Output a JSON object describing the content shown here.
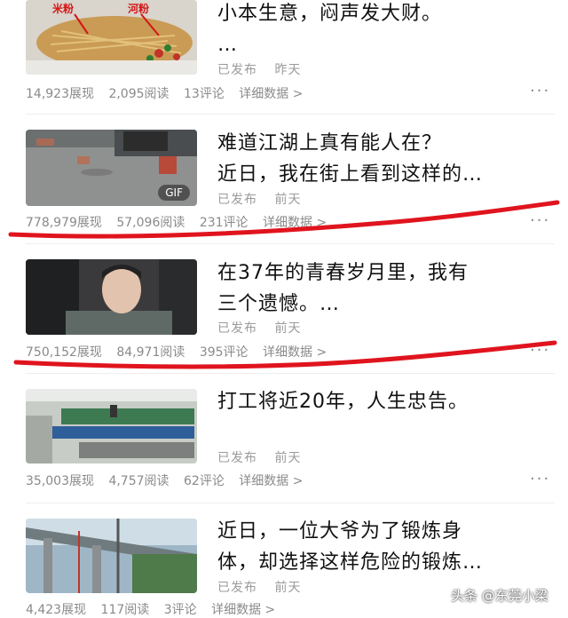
{
  "items": [
    {
      "title": "小本生意，闷声发大财。\n…",
      "status": "已发布",
      "time": "昨天",
      "views": "14,923展现",
      "reads": "2,095阅读",
      "comments": "13评论",
      "detail": "详细数据 >",
      "thumb_labels": [
        "米粉",
        "河粉"
      ]
    },
    {
      "title": "难道江湖上真有能人在？\n近日，我在街上看到这样的…",
      "status": "已发布",
      "time": "前天",
      "views": "778,979展现",
      "reads": "57,096阅读",
      "comments": "231评论",
      "detail": "详细数据 >",
      "badge": "GIF"
    },
    {
      "title": "在37年的青春岁月里，我有\n三个遗憾。…",
      "status": "已发布",
      "time": "前天",
      "views": "750,152展现",
      "reads": "84,971阅读",
      "comments": "395评论",
      "detail": "详细数据 >"
    },
    {
      "title": "打工将近20年，人生忠告。",
      "status": "已发布",
      "time": "前天",
      "views": "35,003展现",
      "reads": "4,757阅读",
      "comments": "62评论",
      "detail": "详细数据 >"
    },
    {
      "title": "近日，一位大爷为了锻炼身\n体，却选择这样危险的锻炼…",
      "status": "已发布",
      "time": "前天",
      "views": "4,423展现",
      "reads": "117阅读",
      "comments": "3评论",
      "detail": "详细数据 >"
    }
  ],
  "more_label": "···",
  "watermark": "头条 @东莞小梁",
  "colors": {
    "annotation_red": "#e0141e"
  }
}
